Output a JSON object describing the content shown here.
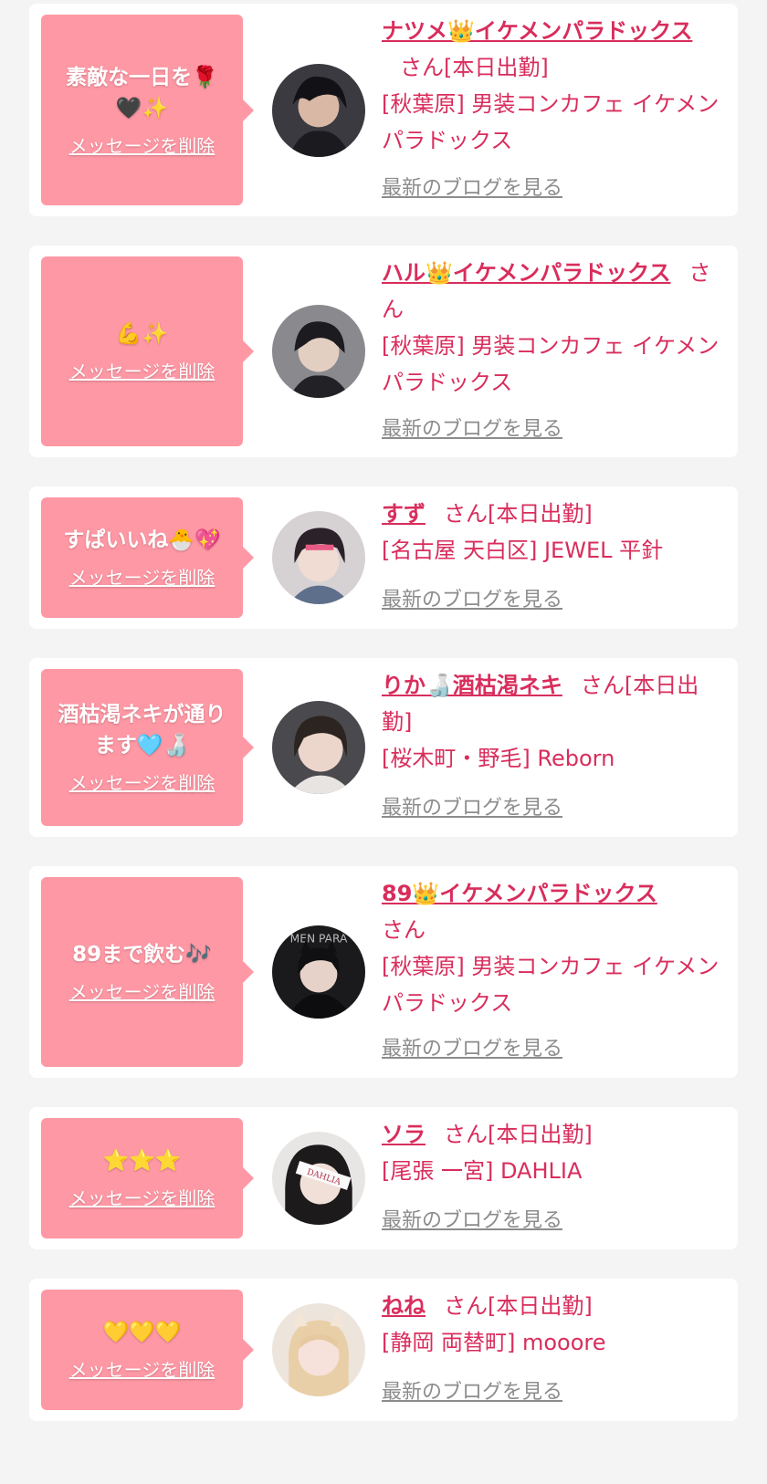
{
  "delete_label": "メッセージを削除",
  "blog_label": "最新のブログを見る",
  "entries": [
    {
      "message": "素敵な一日を🌹🖤✨",
      "name": "ナツメ👑イケメンパラドックス",
      "status": "さん[本日出勤]",
      "shop": "[秋葉原] 男装コンカフェ イケメンパラドックス"
    },
    {
      "message": "💪✨",
      "name": "ハル👑イケメンパラドックス",
      "status": "さん",
      "shop": "[秋葉原] 男装コンカフェ イケメンパラドックス"
    },
    {
      "message": "すぱいいね🐣💖",
      "name": "すず",
      "status": "さん[本日出勤]",
      "shop": "[名古屋 天白区] JEWEL 平針"
    },
    {
      "message": "酒枯渇ネキが通ります🩵🍶",
      "name": "りか🍶酒枯渇ネキ",
      "status": "さん[本日出勤]",
      "shop": "[桜木町・野毛] Reborn"
    },
    {
      "message": "89まで飲む🎶",
      "name": "89👑イケメンパラドックス",
      "status": "さん",
      "shop": "[秋葉原] 男装コンカフェ イケメンパラドックス"
    },
    {
      "message": "⭐⭐⭐",
      "name": "ソラ",
      "status": "さん[本日出勤]",
      "shop": "[尾張 一宮] DAHLIA"
    },
    {
      "message": "💛💛💛",
      "name": "ねね",
      "status": "さん[本日出勤]",
      "shop": "[静岡 両替町] mooore"
    }
  ]
}
